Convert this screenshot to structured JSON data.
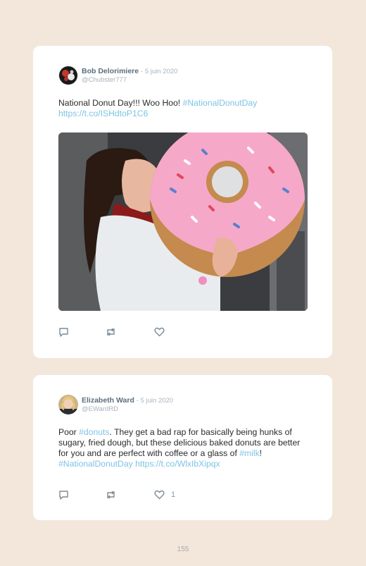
{
  "tweets": [
    {
      "name": "Bob Delorimiere",
      "date": "- 5 juin 2020",
      "handle": "@Chubster777",
      "text": "National Donut Day!!! Woo Hoo! ",
      "hashtag": "#NationalDonutDay",
      "url": "https://t.co/ISHdtoP1C6",
      "image_alt": "Woman biting a giant pink frosted donut with sprinkles",
      "like_count": ""
    },
    {
      "name": "Elizabeth Ward",
      "date": "- 5 juin 2020",
      "handle": "@EWardRD",
      "text_pre": "Poor ",
      "hashtag1": "#donuts",
      "text_mid": ". They get a bad rap for basically being hunks of sugary, fried dough, but these delicious baked donuts are better for you and are perfect with coffee or a glass of ",
      "hashtag2": "#milk",
      "text_post": "!",
      "hashtag3": "#NationalDonutDay",
      "url": "https://t.co/WlxIbXipqx",
      "like_count": "1"
    }
  ],
  "icons": [
    "reply-icon",
    "retweet-icon",
    "like-icon"
  ],
  "page_number": "155"
}
